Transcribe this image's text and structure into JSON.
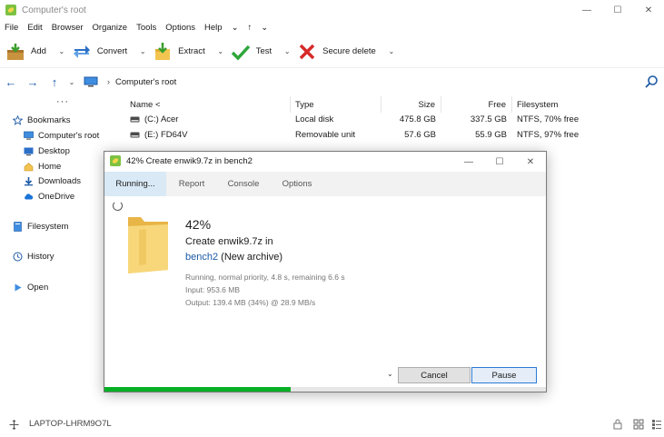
{
  "window": {
    "title": "Computer's root",
    "controls": {
      "minimize": "—",
      "maximize": "☐",
      "close": "✕"
    }
  },
  "menu": [
    "File",
    "Edit",
    "Browser",
    "Organize",
    "Tools",
    "Options",
    "Help",
    "⌄",
    "↑",
    "⌄"
  ],
  "toolbar": {
    "add": "Add",
    "convert": "Convert",
    "extract": "Extract",
    "test": "Test",
    "secure_delete": "Secure delete",
    "dropdown": "⌄"
  },
  "address": {
    "path": "Computer's root",
    "back": "←",
    "forward": "→",
    "up": "↑",
    "dropdown": "⌄",
    "separator": "›"
  },
  "sidebar": {
    "dots": "···",
    "items": [
      "Bookmarks",
      "Computer's root",
      "Desktop",
      "Home",
      "Downloads",
      "OneDrive",
      "Filesystem",
      "History",
      "Open"
    ]
  },
  "filelist": {
    "columns": [
      "Name <",
      "Type",
      "Size",
      "Free",
      "Filesystem"
    ],
    "rows": [
      {
        "name": "(C:) Acer",
        "type": "Local disk",
        "size": "475.8 GB",
        "free": "337.5 GB",
        "fs": "NTFS, 70% free"
      },
      {
        "name": "(E:) FD64V",
        "type": "Removable unit",
        "size": "57.6 GB",
        "free": "55.9 GB",
        "fs": "NTFS, 97% free"
      }
    ]
  },
  "status": {
    "computer": "LAPTOP-LHRM9O7L"
  },
  "dialog": {
    "title": "42% Create enwik9.7z in bench2",
    "tabs": [
      "Running...",
      "Report",
      "Console",
      "Options"
    ],
    "active_tab": 0,
    "percent": "42%",
    "task": "Create enwik9.7z in",
    "archive_link": "bench2",
    "archive_note": "(New archive)",
    "details": [
      "Running, normal priority, 4.8 s, remaining 6.6 s",
      "Input: 953.6 MB",
      "Output: 139.4 MB (34%) @ 28.9 MB/s"
    ],
    "chevron": "⌄",
    "cancel": "Cancel",
    "pause": "Pause",
    "progress": 0.42
  },
  "colors": {
    "accent": "#1c5aa6",
    "progress": "#06b025",
    "tab_active": "#d9e9f6"
  }
}
